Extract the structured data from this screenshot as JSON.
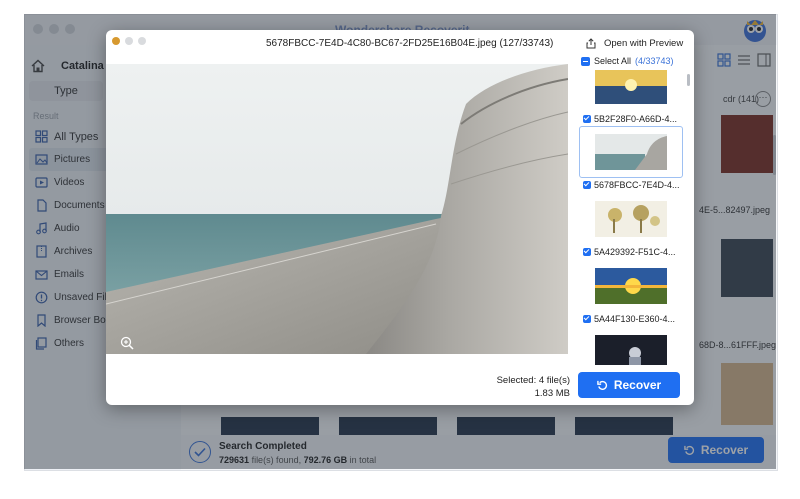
{
  "app": {
    "title": "Wondershare Recoverit",
    "drive_name": "Catalina -",
    "type_button": "Type",
    "section_label": "Result",
    "nav": [
      {
        "label": "All Types",
        "icon": "grid-icon"
      },
      {
        "label": "Pictures",
        "icon": "picture-icon",
        "active": true
      },
      {
        "label": "Videos",
        "icon": "video-icon"
      },
      {
        "label": "Documents",
        "icon": "document-icon"
      },
      {
        "label": "Audio",
        "icon": "music-icon"
      },
      {
        "label": "Archives",
        "icon": "archive-icon"
      },
      {
        "label": "Emails",
        "icon": "mail-icon"
      },
      {
        "label": "Unsaved Files",
        "icon": "warning-icon"
      },
      {
        "label": "Browser Bookmarks",
        "icon": "bookmark-icon"
      },
      {
        "label": "Others",
        "icon": "other-files-icon"
      }
    ],
    "filter_count": "cdr (141)",
    "background_captions": [
      "4E-5...82497.jpeg",
      "68D-8...61FFF.jpeg"
    ],
    "status": {
      "title": "Search Completed",
      "files_found": "729631",
      "files_found_suffix": "file(s) found,",
      "size_found": "792.76 GB",
      "size_suffix": "in total"
    },
    "recover_label": "Recover"
  },
  "preview": {
    "filename": "5678FBCC-7E4D-4C80-BC67-2FD25E16B04E.jpeg (127/33743)",
    "open_with_preview": "Open with Preview",
    "select_all": "Select All",
    "select_all_count": "(4/33743)",
    "thumbnails": [
      {
        "label": "5B2F28F0-A66D-4...",
        "checked": true,
        "selected": false
      },
      {
        "label": "5678FBCC-7E4D-4...",
        "checked": true,
        "selected": true
      },
      {
        "label": "5A429392-F51C-4...",
        "checked": true,
        "selected": false
      },
      {
        "label": "5A44F130-E360-4...",
        "checked": true,
        "selected": false
      }
    ],
    "selected_files": "Selected: 4 file(s)",
    "selected_size": "1.83 MB",
    "recover_label": "Recover"
  },
  "colors": {
    "accent": "#1f6ff2",
    "sidebar_bg": "#edf0f5"
  }
}
